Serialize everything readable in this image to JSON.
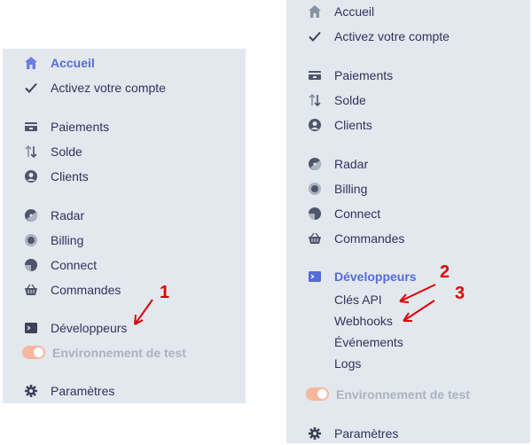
{
  "left_menu": {
    "items": {
      "accueil": "Accueil",
      "activez": "Activez votre compte",
      "paiements": "Paiements",
      "solde": "Solde",
      "clients": "Clients",
      "radar": "Radar",
      "billing": "Billing",
      "connect": "Connect",
      "commandes": "Commandes",
      "developpeurs": "Développeurs",
      "environnement": "Environnement de test",
      "parametres": "Paramètres"
    },
    "active_item": "Accueil"
  },
  "right_menu": {
    "items": {
      "accueil": "Accueil",
      "activez": "Activez votre compte",
      "paiements": "Paiements",
      "solde": "Solde",
      "clients": "Clients",
      "radar": "Radar",
      "billing": "Billing",
      "connect": "Connect",
      "commandes": "Commandes",
      "developpeurs": "Développeurs",
      "environnement": "Environnement de test",
      "parametres": "Paramètres"
    },
    "developpeurs_submenu": [
      "Clés API",
      "Webhooks",
      "Événements",
      "Logs"
    ],
    "active_item": "Développeurs"
  },
  "annotations": [
    "1",
    "2",
    "3"
  ],
  "toggle": {
    "state": "on"
  },
  "colors": {
    "panel_bg": "#e3e8ee",
    "active_text": "#556cd6",
    "default_text": "#32325d",
    "muted_text": "#aab3bf",
    "toggle_bg": "#f5b79d",
    "annotation_red": "#e00000"
  },
  "icons": {
    "accueil": "home-icon",
    "activez": "checkmark-icon",
    "paiements": "payments-icon",
    "solde": "balance-arrows-icon",
    "clients": "customer-icon",
    "radar": "radar-icon",
    "billing": "billing-icon",
    "connect": "connect-icon",
    "commandes": "basket-icon",
    "developpeurs": "terminal-icon",
    "parametres": "gear-icon"
  }
}
